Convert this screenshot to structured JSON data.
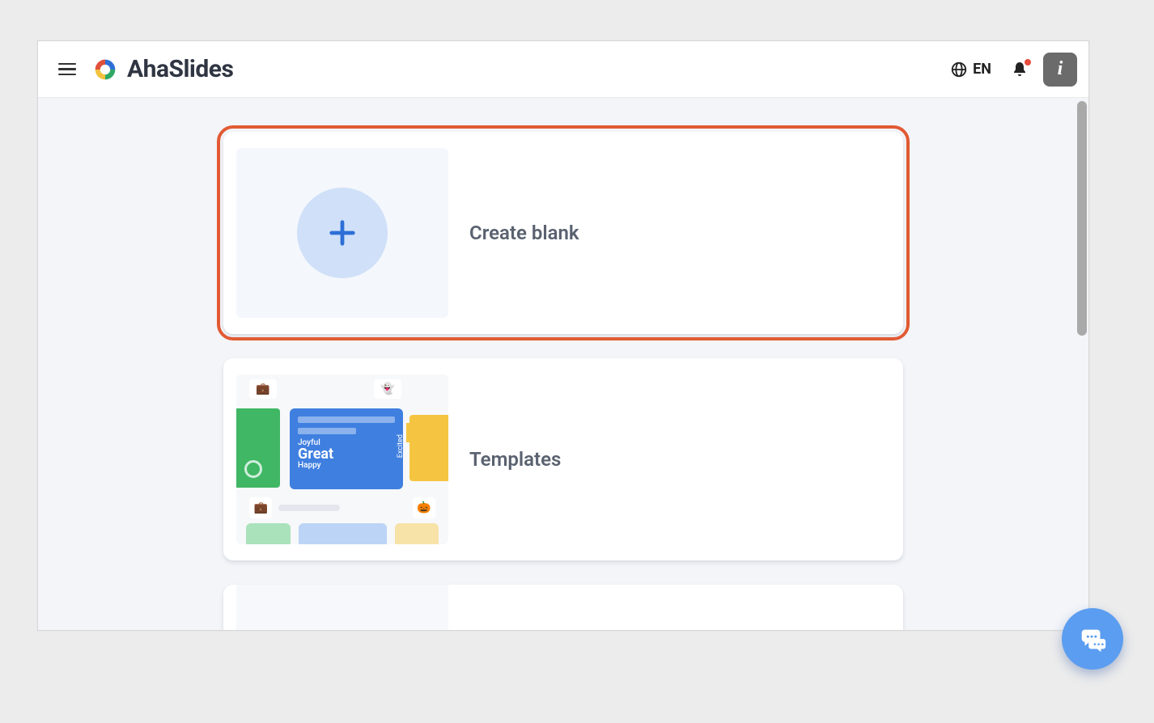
{
  "header": {
    "brand_name": "AhaSlides",
    "language_code": "EN"
  },
  "cards": {
    "create_blank": {
      "label": "Create blank"
    },
    "templates": {
      "label": "Templates",
      "word_small_top": "Joyful",
      "word_big": "Great",
      "word_small_bottom": "Happy",
      "word_side": "Excited"
    }
  }
}
